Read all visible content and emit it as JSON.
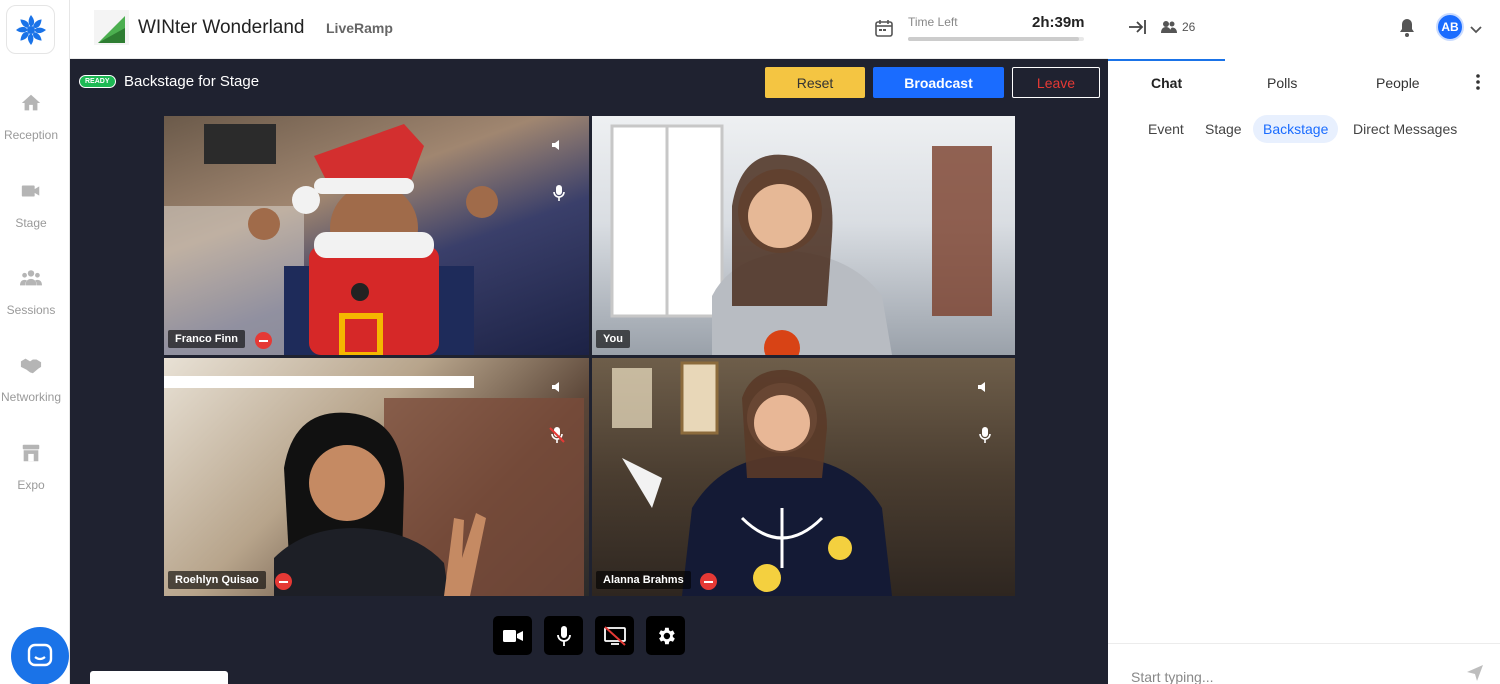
{
  "nav": {
    "items": [
      {
        "label": "Reception",
        "icon": "home-icon"
      },
      {
        "label": "Stage",
        "icon": "video-camera-icon"
      },
      {
        "label": "Sessions",
        "icon": "group-icon"
      },
      {
        "label": "Networking",
        "icon": "handshake-icon"
      },
      {
        "label": "Expo",
        "icon": "storefront-icon"
      }
    ]
  },
  "header": {
    "event_title": "WINter Wonderland",
    "organization": "LiveRamp",
    "time_left_label": "Time Left",
    "time_left_value": "2h:39m",
    "time_progress": 0.97
  },
  "stage": {
    "status_badge": "READY",
    "title": "Backstage for Stage",
    "buttons": {
      "reset": "Reset",
      "broadcast": "Broadcast",
      "leave": "Leave"
    },
    "participants": [
      {
        "name": "Franco Finn",
        "muted": false
      },
      {
        "name": "You",
        "muted": false
      },
      {
        "name": "Roehlyn Quisao",
        "muted": true
      },
      {
        "name": "Alanna Brahms",
        "muted": false
      }
    ],
    "controls": [
      "video-camera-icon",
      "microphone-icon",
      "screen-share-off-icon",
      "settings-icon"
    ]
  },
  "right_panel": {
    "attendee_count": "26",
    "avatar_initials": "AB",
    "tabs": [
      "Chat",
      "Polls",
      "People"
    ],
    "active_tab": "Chat",
    "subtabs": [
      "Event",
      "Stage",
      "Backstage",
      "Direct Messages"
    ],
    "active_subtab": "Backstage",
    "input_placeholder": "Start typing..."
  },
  "colors": {
    "accent": "#1a6cff",
    "stage_bg": "#1f2230",
    "reset": "#f4c542",
    "leave": "#e53935",
    "ready": "#1db954"
  }
}
